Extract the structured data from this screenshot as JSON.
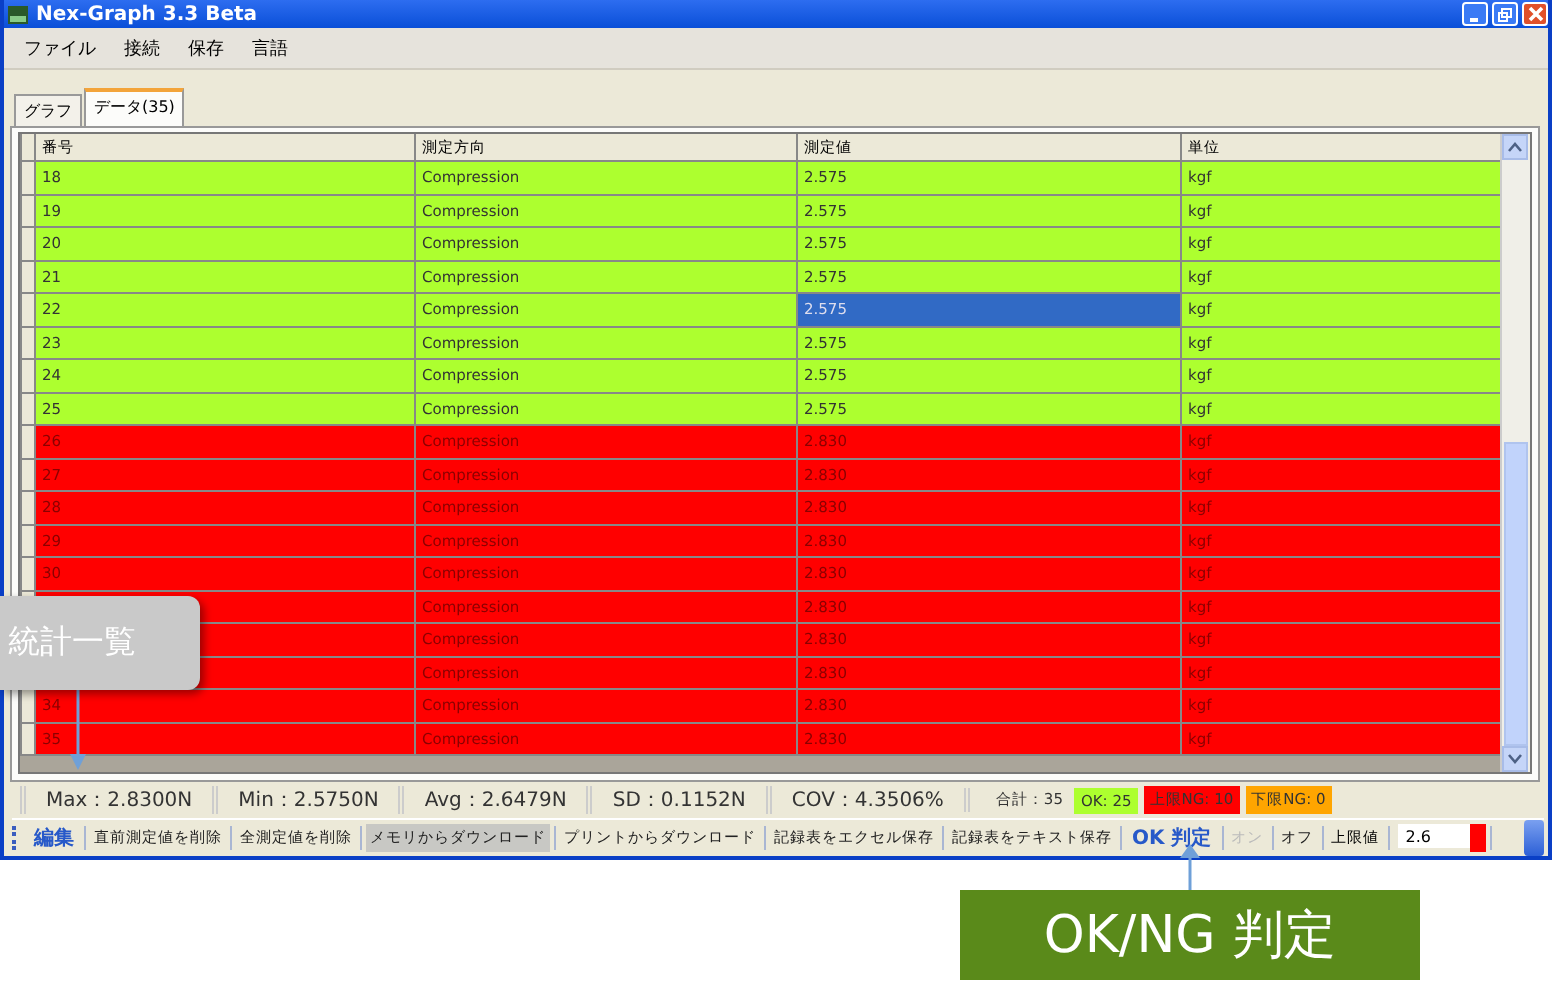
{
  "window": {
    "title": "Nex-Graph 3.3 Beta"
  },
  "menu": [
    "ファイル",
    "接続",
    "保存",
    "言語"
  ],
  "tabs": [
    {
      "label": "グラフ",
      "selected": false
    },
    {
      "label": "データ(35)",
      "selected": true
    }
  ],
  "table": {
    "columns": [
      "番号",
      "測定方向",
      "測定値",
      "単位"
    ],
    "rows": [
      {
        "number": "18",
        "direction": "Compression",
        "value": "2.575",
        "unit": "kgf",
        "color": "#adff2f",
        "selected": false
      },
      {
        "number": "19",
        "direction": "Compression",
        "value": "2.575",
        "unit": "kgf",
        "color": "#adff2f",
        "selected": false
      },
      {
        "number": "20",
        "direction": "Compression",
        "value": "2.575",
        "unit": "kgf",
        "color": "#adff2f",
        "selected": false
      },
      {
        "number": "21",
        "direction": "Compression",
        "value": "2.575",
        "unit": "kgf",
        "color": "#adff2f",
        "selected": false
      },
      {
        "number": "22",
        "direction": "Compression",
        "value": "2.575",
        "unit": "kgf",
        "color": "#adff2f",
        "selected": true
      },
      {
        "number": "23",
        "direction": "Compression",
        "value": "2.575",
        "unit": "kgf",
        "color": "#adff2f",
        "selected": false
      },
      {
        "number": "24",
        "direction": "Compression",
        "value": "2.575",
        "unit": "kgf",
        "color": "#adff2f",
        "selected": false
      },
      {
        "number": "25",
        "direction": "Compression",
        "value": "2.575",
        "unit": "kgf",
        "color": "#adff2f",
        "selected": false
      },
      {
        "number": "26",
        "direction": "Compression",
        "value": "2.830",
        "unit": "kgf",
        "color": "#ff0000",
        "selected": false
      },
      {
        "number": "27",
        "direction": "Compression",
        "value": "2.830",
        "unit": "kgf",
        "color": "#ff0000",
        "selected": false
      },
      {
        "number": "28",
        "direction": "Compression",
        "value": "2.830",
        "unit": "kgf",
        "color": "#ff0000",
        "selected": false
      },
      {
        "number": "29",
        "direction": "Compression",
        "value": "2.830",
        "unit": "kgf",
        "color": "#ff0000",
        "selected": false
      },
      {
        "number": "30",
        "direction": "Compression",
        "value": "2.830",
        "unit": "kgf",
        "color": "#ff0000",
        "selected": false
      },
      {
        "direction": "Compression",
        "value": "2.830",
        "unit": "kgf",
        "color": "#ff0000",
        "selected": false
      },
      {
        "direction": "Compression",
        "value": "2.830",
        "unit": "kgf",
        "color": "#ff0000",
        "selected": false
      },
      {
        "direction": "Compression",
        "value": "2.830",
        "unit": "kgf",
        "color": "#ff0000",
        "selected": false
      },
      {
        "number": "34",
        "direction": "Compression",
        "value": "2.830",
        "unit": "kgf",
        "color": "#ff0000",
        "selected": false
      },
      {
        "number": "35",
        "direction": "Compression",
        "value": "2.830",
        "unit": "kgf",
        "color": "#ff0000",
        "selected": false
      }
    ]
  },
  "stats": [
    "Max：2.8300N",
    "Min：2.5750N",
    "Avg：2.6479N",
    "SD：0.1152N",
    "COV：4.3506%"
  ],
  "counts": [
    {
      "label": "合計：35",
      "color": "#ece9d8"
    },
    {
      "label": "OK: 25",
      "color": "#adff2f"
    },
    {
      "label": "上限NG: 10",
      "color": "#ff0000"
    },
    {
      "label": "下限NG: 0",
      "color": "#ffa500"
    }
  ],
  "toolbar": [
    {
      "kind": "title",
      "label": "編集"
    },
    {
      "kind": "button",
      "label": "直前測定値を削除",
      "selected": false
    },
    {
      "kind": "button",
      "label": "全測定値を削除",
      "selected": false
    },
    {
      "kind": "button",
      "label": "メモリからダウンロード",
      "selected": true
    },
    {
      "kind": "button",
      "label": "プリントからダウンロード",
      "selected": false
    },
    {
      "kind": "button",
      "label": "記録表をエクセル保存",
      "selected": false
    },
    {
      "kind": "button",
      "label": "記録表をテキスト保存",
      "selected": false
    },
    {
      "kind": "title",
      "label": "OK 判定"
    },
    {
      "kind": "toggle",
      "label": "オン",
      "disabled": true
    },
    {
      "kind": "toggle",
      "label": "オフ",
      "disabled": false
    },
    {
      "kind": "label",
      "label": "上限値"
    },
    {
      "kind": "input",
      "value": "2.6",
      "color": "#ff0000"
    }
  ],
  "callouts": [
    {
      "label": "統計一覧",
      "kind": "gray"
    },
    {
      "label": "OK/NG 判定",
      "kind": "green"
    }
  ]
}
